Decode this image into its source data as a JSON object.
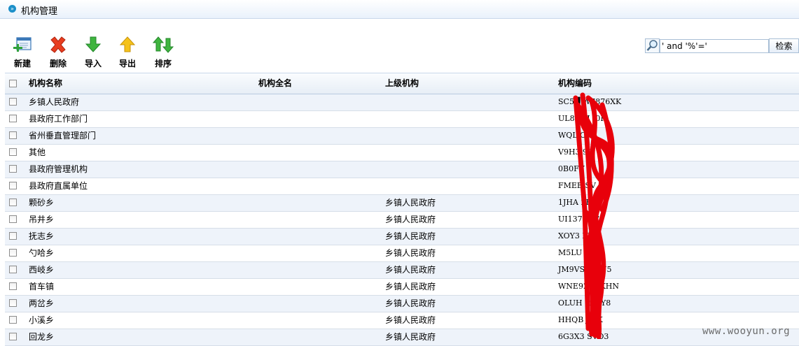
{
  "title": "机构管理",
  "toolbar": {
    "new": "新建",
    "delete": "删除",
    "import": "导入",
    "export": "导出",
    "sort": "排序"
  },
  "search": {
    "value": "' and '%'='",
    "button": "检索"
  },
  "table": {
    "columns": [
      "机构名称",
      "机构全名",
      "上级机构",
      "机构编码"
    ],
    "rows": [
      {
        "name": "乡镇人民政府",
        "full": "",
        "parent": "",
        "code": "SC5█ W7876XK"
      },
      {
        "name": "县政府工作部门",
        "full": "",
        "parent": "",
        "code": "UL80   6J   I0F"
      },
      {
        "name": "省州垂直管理部门",
        "full": "",
        "parent": "",
        "code": "WQL      O"
      },
      {
        "name": "其他",
        "full": "",
        "parent": "",
        "code": "V9H3      99"
      },
      {
        "name": "县政府管理机构",
        "full": "",
        "parent": "",
        "code": "0B0FV"
      },
      {
        "name": "县政府直属单位",
        "full": "",
        "parent": "",
        "code": "FMEB    SV 93I"
      },
      {
        "name": "颗砂乡",
        "full": "",
        "parent": "乡镇人民政府",
        "code": "1JHA      2R"
      },
      {
        "name": "吊井乡",
        "full": "",
        "parent": "乡镇人民政府",
        "code": "UI137      337"
      },
      {
        "name": "抚志乡",
        "full": "",
        "parent": "乡镇人民政府",
        "code": "XOY3      N05"
      },
      {
        "name": "勺哈乡",
        "full": "",
        "parent": "乡镇人民政府",
        "code": "M5LU      PIGF"
      },
      {
        "name": "西岐乡",
        "full": "",
        "parent": "乡镇人民政府",
        "code": "JM9VS     0MN5"
      },
      {
        "name": "首车镇",
        "full": "",
        "parent": "乡镇人民政府",
        "code": "WNE92     IGKHN"
      },
      {
        "name": "两岔乡",
        "full": "",
        "parent": "乡镇人民政府",
        "code": "OLUH      R6ZY8"
      },
      {
        "name": "小溪乡",
        "full": "",
        "parent": "乡镇人民政府",
        "code": "HHQB      J8IK"
      },
      {
        "name": "回龙乡",
        "full": "",
        "parent": "乡镇人民政府",
        "code": "6G3X3      SVO3"
      }
    ]
  },
  "watermark": "www.wooyun.org",
  "colors": {
    "accent": "#1b8fc9",
    "row_alt": "#eef3fa",
    "redaction": "#e8000b"
  }
}
